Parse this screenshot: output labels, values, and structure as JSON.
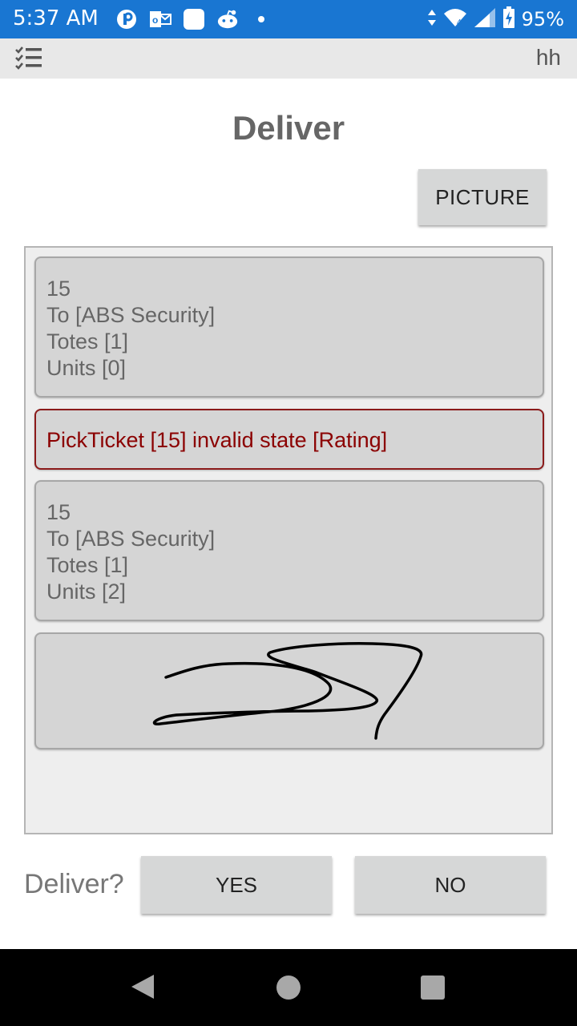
{
  "status_bar": {
    "time": "5:37 AM",
    "battery": "95%",
    "icons_left": [
      "app-p-icon",
      "outlook-icon",
      "blank-square-icon",
      "reddit-icon",
      "dot-icon"
    ],
    "icons_right": [
      "data-arrows-icon",
      "wifi-icon",
      "signal-icon",
      "battery-charging-icon"
    ],
    "color": "#1976d2"
  },
  "app_bar": {
    "menu_icon": "checklist-menu-icon",
    "user": "hh"
  },
  "page": {
    "title": "Deliver",
    "picture_button": "PICTURE"
  },
  "list": {
    "items": [
      {
        "type": "ticket",
        "lines": [
          "15",
          "To [ABS Security]",
          "Totes [1]",
          "Units [0]"
        ]
      },
      {
        "type": "error",
        "text": "PickTicket [15] invalid state [Rating]",
        "color": "#8b0000"
      },
      {
        "type": "ticket",
        "lines": [
          "15",
          "To [ABS Security]",
          "Totes [1]",
          "Units [2]"
        ]
      },
      {
        "type": "signature"
      }
    ]
  },
  "prompt": {
    "label": "Deliver?",
    "yes": "YES",
    "no": "NO"
  },
  "nav": {
    "icons": [
      "back-icon",
      "home-icon",
      "recents-icon"
    ]
  }
}
